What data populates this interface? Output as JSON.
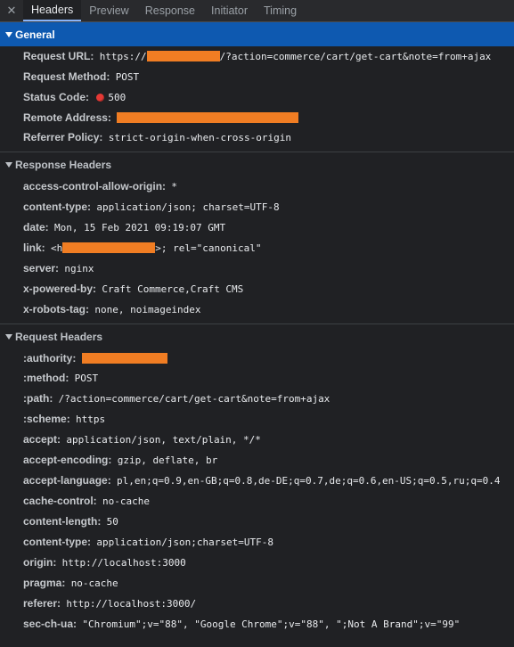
{
  "tabs": [
    {
      "label": "Headers"
    },
    {
      "label": "Preview"
    },
    {
      "label": "Response"
    },
    {
      "label": "Initiator"
    },
    {
      "label": "Timing"
    }
  ],
  "colors": {
    "selected_section": "#0e59b0",
    "redaction": "#f07d23",
    "status_error": "#e53935"
  },
  "general": {
    "title": "General",
    "request_url_key": "Request URL:",
    "request_url_prefix": "https://",
    "request_url_suffix": "/?action=commerce/cart/get-cart&note=from+ajax",
    "method_key": "Request Method:",
    "method_value": "POST",
    "status_key": "Status Code:",
    "status_value": "500",
    "remote_key": "Remote Address:",
    "referrer_key": "Referrer Policy:",
    "referrer_value": "strict-origin-when-cross-origin"
  },
  "response": {
    "title": "Response Headers",
    "acao_key": "access-control-allow-origin:",
    "acao_value": "*",
    "content_type_key": "content-type:",
    "content_type_value": "application/json; charset=UTF-8",
    "date_key": "date:",
    "date_value": "Mon, 15 Feb 2021 09:19:07 GMT",
    "link_key": "link:",
    "link_prefix": "<h",
    "link_suffix": ">; rel=\"canonical\"",
    "server_key": "server:",
    "server_value": "nginx",
    "powered_key": "x-powered-by:",
    "powered_value": "Craft Commerce,Craft CMS",
    "robots_key": "x-robots-tag:",
    "robots_value": "none, noimageindex"
  },
  "request": {
    "title": "Request Headers",
    "authority_key": ":authority:",
    "method_key": ":method:",
    "method_value": "POST",
    "path_key": ":path:",
    "path_value": "/?action=commerce/cart/get-cart&note=from+ajax",
    "scheme_key": ":scheme:",
    "scheme_value": "https",
    "accept_key": "accept:",
    "accept_value": "application/json, text/plain, */*",
    "accept_encoding_key": "accept-encoding:",
    "accept_encoding_value": "gzip, deflate, br",
    "accept_language_key": "accept-language:",
    "accept_language_value": "pl,en;q=0.9,en-GB;q=0.8,de-DE;q=0.7,de;q=0.6,en-US;q=0.5,ru;q=0.4",
    "cache_control_key": "cache-control:",
    "cache_control_value": "no-cache",
    "content_length_key": "content-length:",
    "content_length_value": "50",
    "content_type_key": "content-type:",
    "content_type_value": "application/json;charset=UTF-8",
    "origin_key": "origin:",
    "origin_value": "http://localhost:3000",
    "pragma_key": "pragma:",
    "pragma_value": "no-cache",
    "referer_key": "referer:",
    "referer_value": "http://localhost:3000/",
    "sec_ch_ua_key": "sec-ch-ua:",
    "sec_ch_ua_value": "\"Chromium\";v=\"88\", \"Google Chrome\";v=\"88\", \";Not A Brand\";v=\"99\""
  }
}
